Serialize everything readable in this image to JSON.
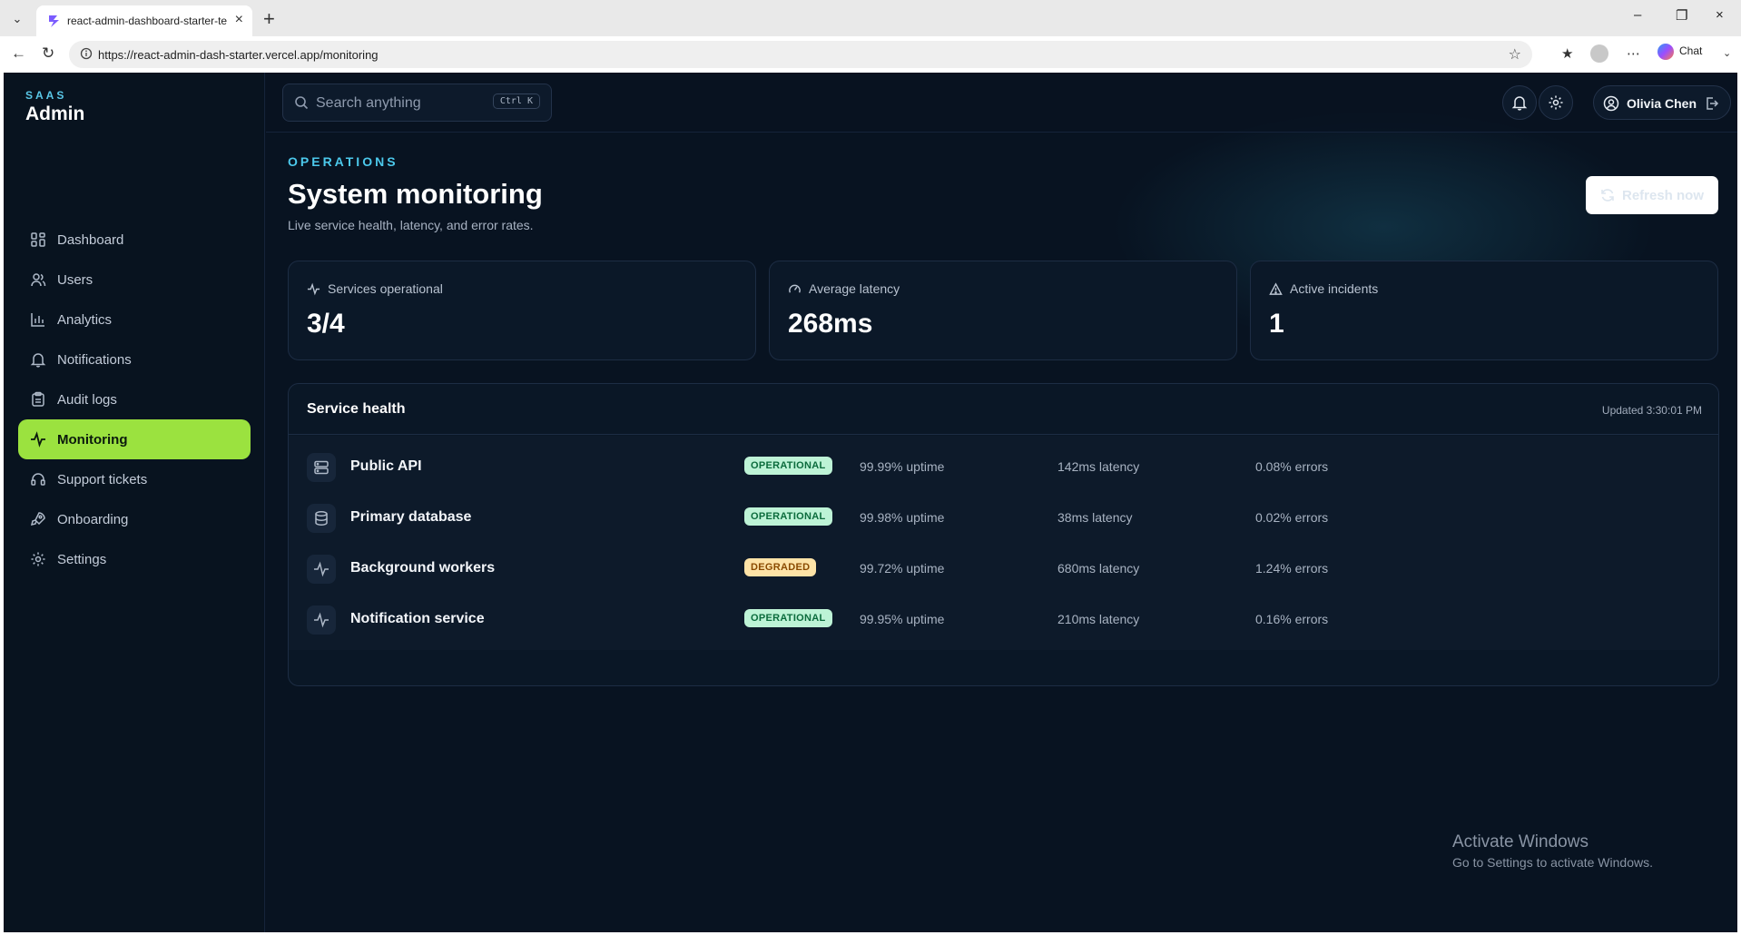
{
  "browser": {
    "tab_title": "react-admin-dashboard-starter-te",
    "url": "https://react-admin-dash-starter.vercel.app/monitoring",
    "chat_label": "Chat"
  },
  "brand": {
    "small": "SAAS",
    "big": "Admin"
  },
  "sidebar": {
    "items": [
      {
        "label": "Dashboard",
        "icon": "grid-icon"
      },
      {
        "label": "Users",
        "icon": "users-icon"
      },
      {
        "label": "Analytics",
        "icon": "bar-chart-icon"
      },
      {
        "label": "Notifications",
        "icon": "bell-icon"
      },
      {
        "label": "Audit logs",
        "icon": "clipboard-icon"
      },
      {
        "label": "Monitoring",
        "icon": "activity-icon",
        "active": true
      },
      {
        "label": "Support tickets",
        "icon": "headset-icon"
      },
      {
        "label": "Onboarding",
        "icon": "rocket-icon"
      },
      {
        "label": "Settings",
        "icon": "gear-icon"
      }
    ]
  },
  "topbar": {
    "search_placeholder": "Search anything",
    "search_shortcut": "Ctrl K",
    "user_name": "Olivia Chen"
  },
  "page": {
    "eyebrow": "OPERATIONS",
    "title": "System monitoring",
    "subtitle": "Live service health, latency, and error rates.",
    "refresh_label": "Refresh now"
  },
  "stats": [
    {
      "label": "Services operational",
      "value": "3/4",
      "icon": "activity-icon"
    },
    {
      "label": "Average latency",
      "value": "268ms",
      "icon": "gauge-icon"
    },
    {
      "label": "Active incidents",
      "value": "1",
      "icon": "alert-triangle-icon"
    }
  ],
  "health": {
    "title": "Service health",
    "updated": "Updated 3:30:01 PM",
    "rows": [
      {
        "name": "Public API",
        "status": "OPERATIONAL",
        "uptime": "99.99% uptime",
        "latency": "142ms latency",
        "errors": "0.08% errors",
        "icon": "server-icon"
      },
      {
        "name": "Primary database",
        "status": "OPERATIONAL",
        "uptime": "99.98% uptime",
        "latency": "38ms latency",
        "errors": "0.02% errors",
        "icon": "database-icon"
      },
      {
        "name": "Background workers",
        "status": "DEGRADED",
        "uptime": "99.72% uptime",
        "latency": "680ms latency",
        "errors": "1.24% errors",
        "icon": "activity-icon"
      },
      {
        "name": "Notification service",
        "status": "OPERATIONAL",
        "uptime": "99.95% uptime",
        "latency": "210ms latency",
        "errors": "0.16% errors",
        "icon": "activity-icon"
      }
    ]
  },
  "watermark": {
    "line1": "Activate Windows",
    "line2": "Go to Settings to activate Windows."
  },
  "colors": {
    "accent": "#9be23f",
    "background": "#081321",
    "eyebrow": "#4cc9ec",
    "operational_bg": "#bdf3d6",
    "degraded_bg": "#fde3a7"
  }
}
